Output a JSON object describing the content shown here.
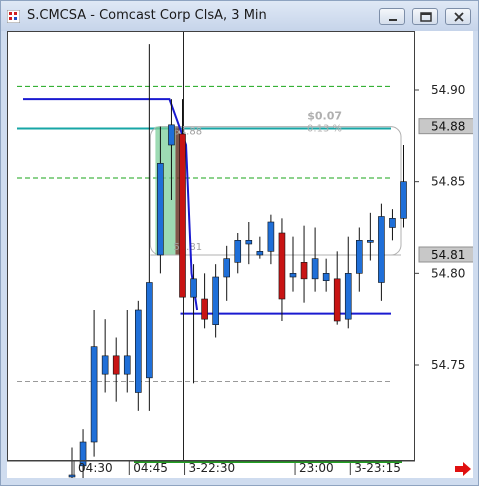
{
  "window": {
    "title": "S.CMCSA - Comcast Corp ClsA, 3 Min",
    "controls": [
      "minimize",
      "restore",
      "close"
    ],
    "icons": {
      "app": "chart-app-icon",
      "next": "red-right-arrow-icon"
    }
  },
  "colors": {
    "up": "#1f6fd8",
    "down": "#c81414",
    "ma_blue": "#1a1ad0",
    "teal": "#17a6a6",
    "green_dash": "#1aa61a",
    "grey_dash": "#9a9a9a",
    "shade_green": "#7ccf9a",
    "shade_dark": "#6b3a2a"
  },
  "chart_data": {
    "type": "candlestick",
    "y_ticks": [
      "54.90",
      "54.85",
      "54.80",
      "54.75"
    ],
    "y_tick_values": [
      54.9,
      54.85,
      54.8,
      54.75
    ],
    "price_tags": [
      {
        "label": "54.88",
        "value": 54.88
      },
      {
        "label": "54.81",
        "value": 54.81
      }
    ],
    "x_ticks": [
      {
        "label": "04:30",
        "index": 1
      },
      {
        "label": "04:45",
        "index": 6
      },
      {
        "label": "3-22:30",
        "index": 11
      },
      {
        "label": "23:00",
        "index": 21
      },
      {
        "label": "3-23:15",
        "index": 26
      }
    ],
    "session_break_index": 10,
    "hlines": [
      {
        "value": 54.902,
        "style": "green_dash"
      },
      {
        "value": 54.852,
        "style": "green_dash"
      },
      {
        "value": 54.741,
        "style": "grey_dash"
      },
      {
        "value": 54.879,
        "style": "teal"
      },
      {
        "value": 54.778,
        "style": "blue",
        "from_index": 10
      }
    ],
    "ma_line": [
      {
        "x": 0,
        "y": 54.895
      },
      {
        "x": 9,
        "y": 54.895
      },
      {
        "x": 10.5,
        "y": 54.87
      },
      {
        "x": 11,
        "y": 54.8
      },
      {
        "x": 11.5,
        "y": 54.78
      }
    ],
    "measure": {
      "from_value": 54.81,
      "to_value": 54.88,
      "from_label": "54.81",
      "to_label": "54.88",
      "change": "$0.07",
      "change_pct": "0.13 %"
    },
    "candles": [
      {
        "o": 54.69,
        "h": 54.705,
        "l": 54.66,
        "c": 54.69
      },
      {
        "o": 54.695,
        "h": 54.715,
        "l": 54.67,
        "c": 54.708
      },
      {
        "o": 54.708,
        "h": 54.78,
        "l": 54.7,
        "c": 54.76
      },
      {
        "o": 54.745,
        "h": 54.775,
        "l": 54.735,
        "c": 54.755
      },
      {
        "o": 54.755,
        "h": 54.765,
        "l": 54.73,
        "c": 54.745
      },
      {
        "o": 54.745,
        "h": 54.78,
        "l": 54.735,
        "c": 54.755
      },
      {
        "o": 54.735,
        "h": 54.785,
        "l": 54.725,
        "c": 54.78
      },
      {
        "o": 54.743,
        "h": 54.925,
        "l": 54.725,
        "c": 54.795
      },
      {
        "o": 54.81,
        "h": 54.88,
        "l": 54.8,
        "c": 54.86
      },
      {
        "o": 54.87,
        "h": 54.895,
        "l": 54.84,
        "c": 54.881
      },
      {
        "o": 54.876,
        "h": 54.895,
        "l": 54.8,
        "c": 54.787
      },
      {
        "o": 54.787,
        "h": 54.805,
        "l": 54.74,
        "c": 54.797
      },
      {
        "o": 54.786,
        "h": 54.8,
        "l": 54.77,
        "c": 54.775
      },
      {
        "o": 54.772,
        "h": 54.805,
        "l": 54.765,
        "c": 54.798
      },
      {
        "o": 54.798,
        "h": 54.815,
        "l": 54.785,
        "c": 54.808
      },
      {
        "o": 54.806,
        "h": 54.822,
        "l": 54.8,
        "c": 54.818
      },
      {
        "o": 54.816,
        "h": 54.828,
        "l": 54.805,
        "c": 54.818
      },
      {
        "o": 54.81,
        "h": 54.82,
        "l": 54.808,
        "c": 54.812
      },
      {
        "o": 54.812,
        "h": 54.832,
        "l": 54.805,
        "c": 54.828
      },
      {
        "o": 54.822,
        "h": 54.83,
        "l": 54.774,
        "c": 54.786
      },
      {
        "o": 54.798,
        "h": 54.82,
        "l": 54.79,
        "c": 54.8
      },
      {
        "o": 54.806,
        "h": 54.826,
        "l": 54.784,
        "c": 54.797
      },
      {
        "o": 54.797,
        "h": 54.825,
        "l": 54.79,
        "c": 54.808
      },
      {
        "o": 54.796,
        "h": 54.808,
        "l": 54.79,
        "c": 54.8
      },
      {
        "o": 54.797,
        "h": 54.812,
        "l": 54.772,
        "c": 54.774
      },
      {
        "o": 54.775,
        "h": 54.82,
        "l": 54.77,
        "c": 54.8
      },
      {
        "o": 54.8,
        "h": 54.825,
        "l": 54.79,
        "c": 54.818
      },
      {
        "o": 54.818,
        "h": 54.833,
        "l": 54.807,
        "c": 54.818
      },
      {
        "o": 54.795,
        "h": 54.838,
        "l": 54.785,
        "c": 54.831
      },
      {
        "o": 54.825,
        "h": 54.835,
        "l": 54.818,
        "c": 54.83
      },
      {
        "o": 54.83,
        "h": 54.87,
        "l": 54.825,
        "c": 54.85
      }
    ]
  }
}
